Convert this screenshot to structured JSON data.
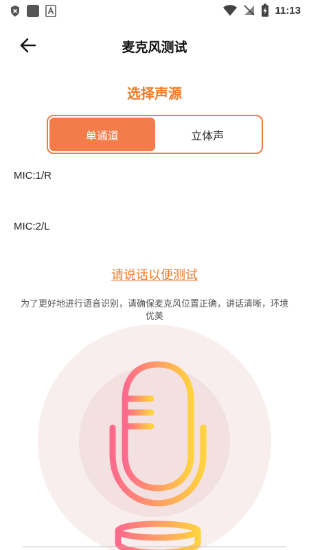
{
  "status_bar": {
    "time": "11:13",
    "left_icons": [
      "shield-close-icon",
      "app-square-icon",
      "text-a-icon"
    ],
    "right_icons": [
      "wifi-icon",
      "no-signal-icon",
      "battery-charging-icon"
    ]
  },
  "header": {
    "title": "麦克风测试",
    "back_icon": "arrow-left-icon"
  },
  "source": {
    "title": "选择声源",
    "options": [
      "单通道",
      "立体声"
    ],
    "selected": "单通道"
  },
  "mics": [
    {
      "label": "MIC:1/R"
    },
    {
      "label": "MIC:2/L"
    }
  ],
  "prompt": {
    "link_text": "请说话以便测试",
    "hint": "为了更好地进行语音识别，请确保麦克风位置正确，讲话清晰，环境优美"
  },
  "colors": {
    "accent": "#f07a2a",
    "toggle_active": "#f47b4a",
    "mic_gradient_start": "#ff6a8c",
    "mic_gradient_end": "#ffd23f",
    "ring_outer": "#f9eeee",
    "ring_inner": "#f3e0e0"
  }
}
